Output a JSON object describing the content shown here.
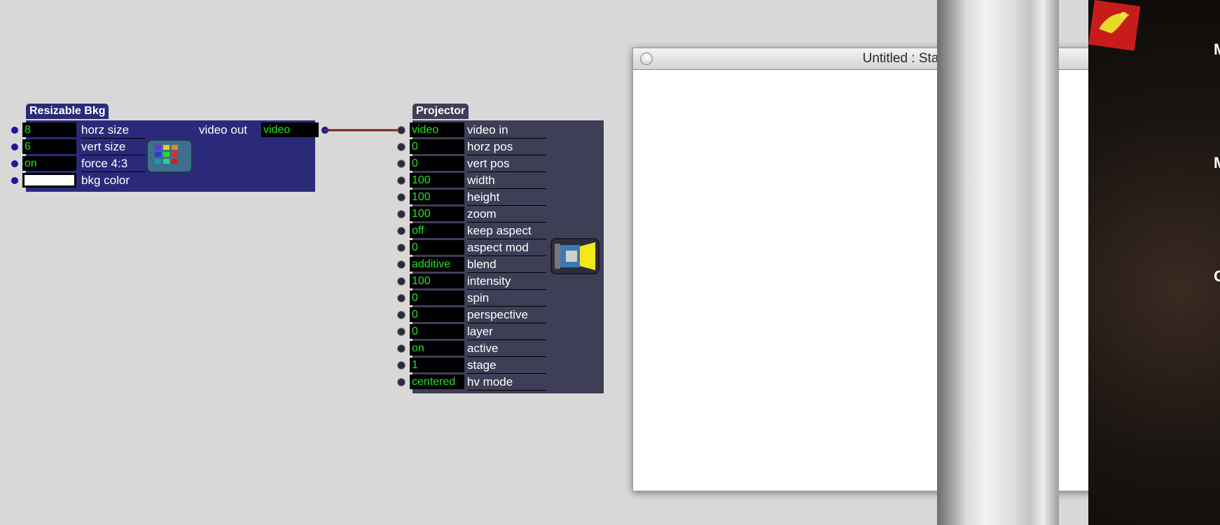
{
  "resizable_bkg": {
    "title": "Resizable Bkg",
    "inputs": [
      {
        "value": "8",
        "label": "horz size"
      },
      {
        "value": "6",
        "label": "vert size"
      },
      {
        "value": "on",
        "label": "force 4:3"
      },
      {
        "value": "",
        "label": "bkg color"
      }
    ],
    "output": {
      "label": "video out",
      "value": "video"
    },
    "icon": "color-grid-icon"
  },
  "projector": {
    "title": "Projector",
    "inputs": [
      {
        "value": "video",
        "label": "video in"
      },
      {
        "value": "0",
        "label": "horz pos"
      },
      {
        "value": "0",
        "label": "vert pos"
      },
      {
        "value": "100",
        "label": "width"
      },
      {
        "value": "100",
        "label": "height"
      },
      {
        "value": "100",
        "label": "zoom"
      },
      {
        "value": "off",
        "label": "keep aspect"
      },
      {
        "value": "0",
        "label": "aspect mod"
      },
      {
        "value": "additive",
        "label": "blend"
      },
      {
        "value": "100",
        "label": "intensity"
      },
      {
        "value": "0",
        "label": "spin"
      },
      {
        "value": "0",
        "label": "perspective"
      },
      {
        "value": "0",
        "label": "layer"
      },
      {
        "value": "on",
        "label": "active"
      },
      {
        "value": "1",
        "label": "stage"
      },
      {
        "value": "centered",
        "label": "hv mode"
      }
    ],
    "icon": "projector-icon"
  },
  "stage_window": {
    "title": "Untitled : Stage 1"
  },
  "desktop_edge": {
    "letters": [
      "M",
      "M",
      "C"
    ]
  },
  "colors": {
    "bkg_actor": "#2b2a7a",
    "projector_actor": "#3e3e56",
    "value_text": "#1fe61f",
    "connection": "#7a1e1e",
    "bkg_color_swatch": "#ffffff"
  }
}
